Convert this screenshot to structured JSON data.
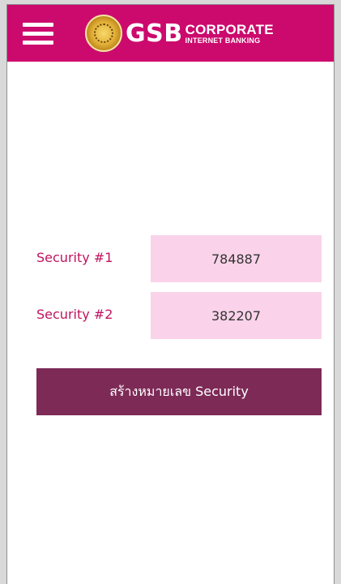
{
  "header": {
    "brand_gsb": "GSB",
    "brand_corporate": "CORPORATE",
    "brand_internet_banking": "INTERNET BANKING",
    "background_color": "#cc0a6d"
  },
  "form": {
    "security1": {
      "label": "Security #1",
      "value": "784887"
    },
    "security2": {
      "label": "Security #2",
      "value": "382207"
    },
    "submit_label": "สร้างหมายเลข Security",
    "label_color": "#c0135f",
    "input_bg": "#fad3ea",
    "button_color": "#7d2a57"
  },
  "icons": {
    "menu": "hamburger-menu-icon",
    "seal": "gsb-seal-logo"
  }
}
